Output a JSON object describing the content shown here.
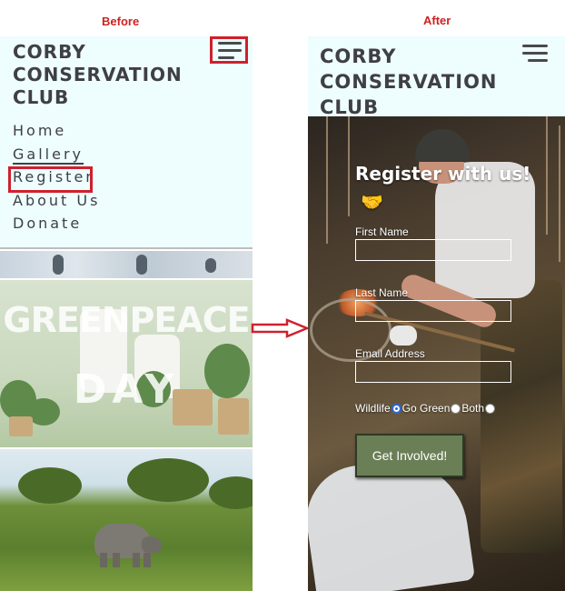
{
  "captions": {
    "before": "Before",
    "after": "After"
  },
  "before": {
    "brand": [
      "CORBY",
      "CONSERVATION",
      "CLUB"
    ],
    "nav": [
      "Home",
      "Gallery",
      "Register",
      "About Us",
      "Donate"
    ],
    "active_nav": "Gallery",
    "highlighted_nav": "Register",
    "banner_text": [
      "GREENPEACE",
      "DAY"
    ]
  },
  "after": {
    "brand": [
      "CORBY",
      "CONSERVATION",
      "CLUB"
    ],
    "form": {
      "heading": "Register with us!",
      "heading_emoji": "🤝",
      "first_name_label": "First Name",
      "last_name_label": "Last Name",
      "email_label": "Email Address",
      "radio_options": [
        "Wildlife",
        "Go Green",
        "Both"
      ],
      "selected_option": "Wildlife",
      "submit_label": "Get Involved!"
    }
  },
  "colors": {
    "header_bg": "#eefdfd",
    "brand_text": "#3f3f46",
    "highlight_red": "#d0202d",
    "button_bg": "#6b7f56"
  }
}
